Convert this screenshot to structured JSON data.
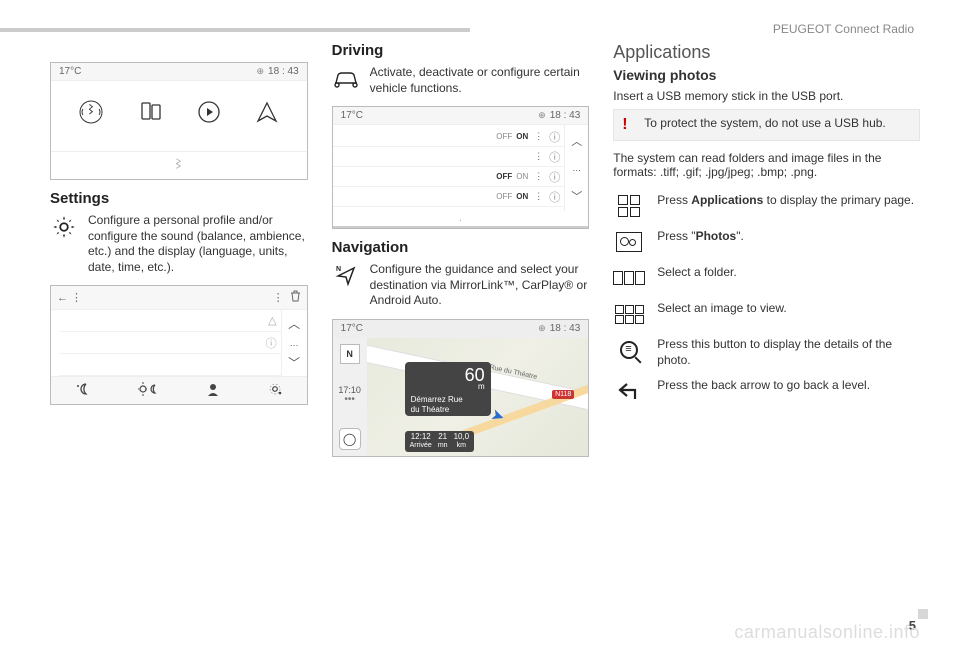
{
  "header": {
    "brand": "PEUGEOT Connect Radio"
  },
  "page_number": "5",
  "watermark": "carmanualsonline.info",
  "col1": {
    "home_status": {
      "temp": "17°C",
      "time": "18 : 43"
    },
    "settings_heading": "Settings",
    "settings_desc": "Configure a personal profile and/or configure the sound (balance, ambience, etc.) and the display (language, units, date, time, etc.)."
  },
  "col2": {
    "driving_heading": "Driving",
    "driving_desc": "Activate, deactivate or configure certain vehicle functions.",
    "drive_status": {
      "temp": "17°C",
      "time": "18 : 43"
    },
    "toggle_off": "OFF",
    "toggle_on": "ON",
    "navigation_heading": "Navigation",
    "navigation_desc": "Configure the guidance and select your destination via MirrorLink™, CarPlay® or Android Auto.",
    "nav_status": {
      "temp": "17°C",
      "time": "18 : 43"
    },
    "nav_panel": {
      "dist_value": "60",
      "dist_unit": "m",
      "dest_line1": "Démarrez Rue",
      "dest_line2": "du Théatre"
    },
    "nav_side_time": "17:10",
    "nav_bottom": {
      "arrive_v": "12:12",
      "arrive_l": "Arrivée",
      "eta_v": "21",
      "eta_l": "mn",
      "dist_v": "10,0",
      "dist_l": "km"
    },
    "nav_road_label": "Rue du Théatre",
    "nav_badge": "N118",
    "nav_compass": "N"
  },
  "col3": {
    "apps_heading": "Applications",
    "photos_heading": "Viewing photos",
    "intro": "Insert a USB memory stick in the USB port.",
    "alert": "To protect the system, do not use a USB hub.",
    "formats": "The system can read folders and image files in the formats: .tiff; .gif; .jpg/jpeg; .bmp; .png.",
    "step_apps_pre": "Press ",
    "step_apps_bold": "Applications",
    "step_apps_post": " to display the primary page.",
    "step_photos_pre": "Press \"",
    "step_photos_bold": "Photos",
    "step_photos_post": "\".",
    "step_folder": "Select a folder.",
    "step_image": "Select an image to view.",
    "step_details": "Press this button to display the details of the photo.",
    "step_back": "Press the back arrow to go back a level."
  }
}
